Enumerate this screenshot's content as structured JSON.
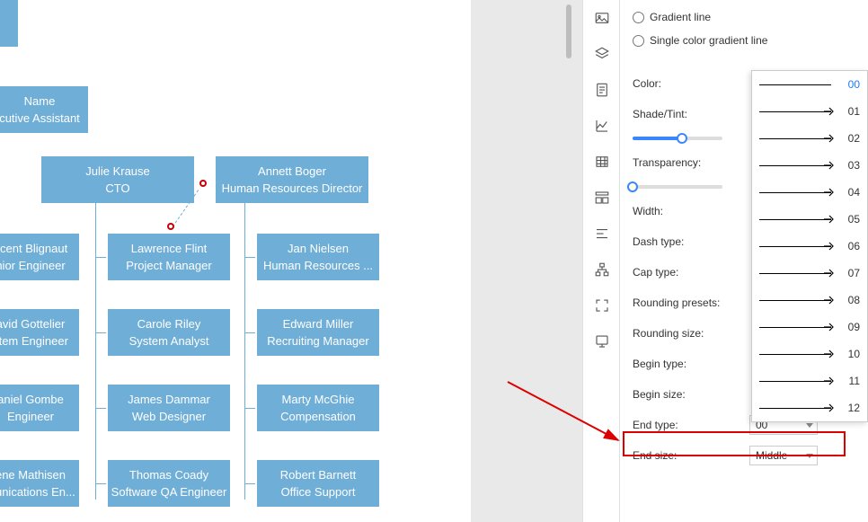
{
  "org": {
    "top_node": {
      "line1": "Name",
      "line2": "cutive Assistant"
    },
    "row2": [
      {
        "line1": "Julie Krause",
        "line2": "CTO"
      },
      {
        "line1": "Annett Boger",
        "line2": "Human Resources Director"
      }
    ],
    "row3": [
      {
        "line1": "ncent Blignaut",
        "line2": "nior Engineer"
      },
      {
        "line1": "Lawrence Flint",
        "line2": "Project Manager"
      },
      {
        "line1": "Jan Nielsen",
        "line2": "Human Resources ..."
      }
    ],
    "row4": [
      {
        "line1": "avid Gottelier",
        "line2": "stem Engineer"
      },
      {
        "line1": "Carole Riley",
        "line2": "System Analyst"
      },
      {
        "line1": "Edward Miller",
        "line2": "Recruiting Manager"
      }
    ],
    "row5": [
      {
        "line1": "aniel Gombe",
        "line2": "Engineer"
      },
      {
        "line1": "James Dammar",
        "line2": "Web Designer"
      },
      {
        "line1": "Marty McGhie",
        "line2": "Compensation"
      }
    ],
    "row6": [
      {
        "line1": "ene Mathisen",
        "line2": "munications En..."
      },
      {
        "line1": "Thomas Coady",
        "line2": "Software QA Engineer"
      },
      {
        "line1": "Robert Barnett",
        "line2": "Office Support"
      }
    ]
  },
  "panel": {
    "radios": {
      "gradient": "Gradient line",
      "single": "Single color gradient line"
    },
    "labels": {
      "color": "Color:",
      "shade": "Shade/Tint:",
      "transparency": "Transparency:",
      "width": "Width:",
      "dash": "Dash type:",
      "cap": "Cap type:",
      "rounding_presets": "Rounding presets:",
      "rounding_size": "Rounding size:",
      "begin_type": "Begin type:",
      "begin_size": "Begin size:",
      "end_type": "End type:",
      "end_size": "End size:"
    },
    "end_type_value": "00",
    "end_size_value": "Middle",
    "dropdown_items": [
      "00",
      "01",
      "02",
      "03",
      "04",
      "05",
      "06",
      "07",
      "08",
      "09",
      "10",
      "11",
      "12"
    ]
  },
  "rail_icons": [
    "image",
    "layers",
    "document",
    "chart",
    "calculator",
    "layout",
    "align",
    "orgchart",
    "fullscreen",
    "presentation"
  ]
}
